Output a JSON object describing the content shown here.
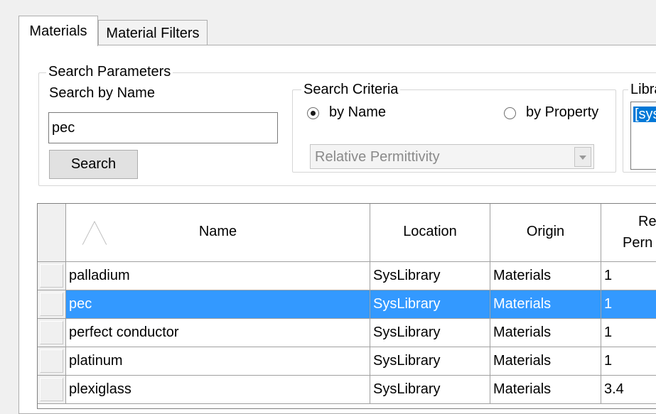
{
  "tabs": [
    {
      "label": "Materials",
      "active": true
    },
    {
      "label": "Material Filters",
      "active": false
    }
  ],
  "search_parameters": {
    "legend": "Search Parameters",
    "search_by_name_label": "Search by Name",
    "name_value": "pec",
    "search_button": "Search"
  },
  "search_criteria": {
    "legend": "Search Criteria",
    "by_name": "by Name",
    "by_property": "by Property",
    "selected": "by Name",
    "property_combo": "Relative Permittivity"
  },
  "library": {
    "legend": "Libra",
    "selected_item": "[sys"
  },
  "table": {
    "columns": [
      "Name",
      "Location",
      "Origin",
      "Re",
      "Pern"
    ],
    "selected_row": 1,
    "rows": [
      [
        "palladium",
        "SysLibrary",
        "Materials",
        "1"
      ],
      [
        "pec",
        "SysLibrary",
        "Materials",
        "1"
      ],
      [
        "perfect conductor",
        "SysLibrary",
        "Materials",
        "1"
      ],
      [
        "platinum",
        "SysLibrary",
        "Materials",
        "1"
      ],
      [
        "plexiglass",
        "SysLibrary",
        "Materials",
        "3.4"
      ]
    ]
  },
  "colors": {
    "selection": "#3399ff",
    "list_selection": "#0078d7"
  }
}
